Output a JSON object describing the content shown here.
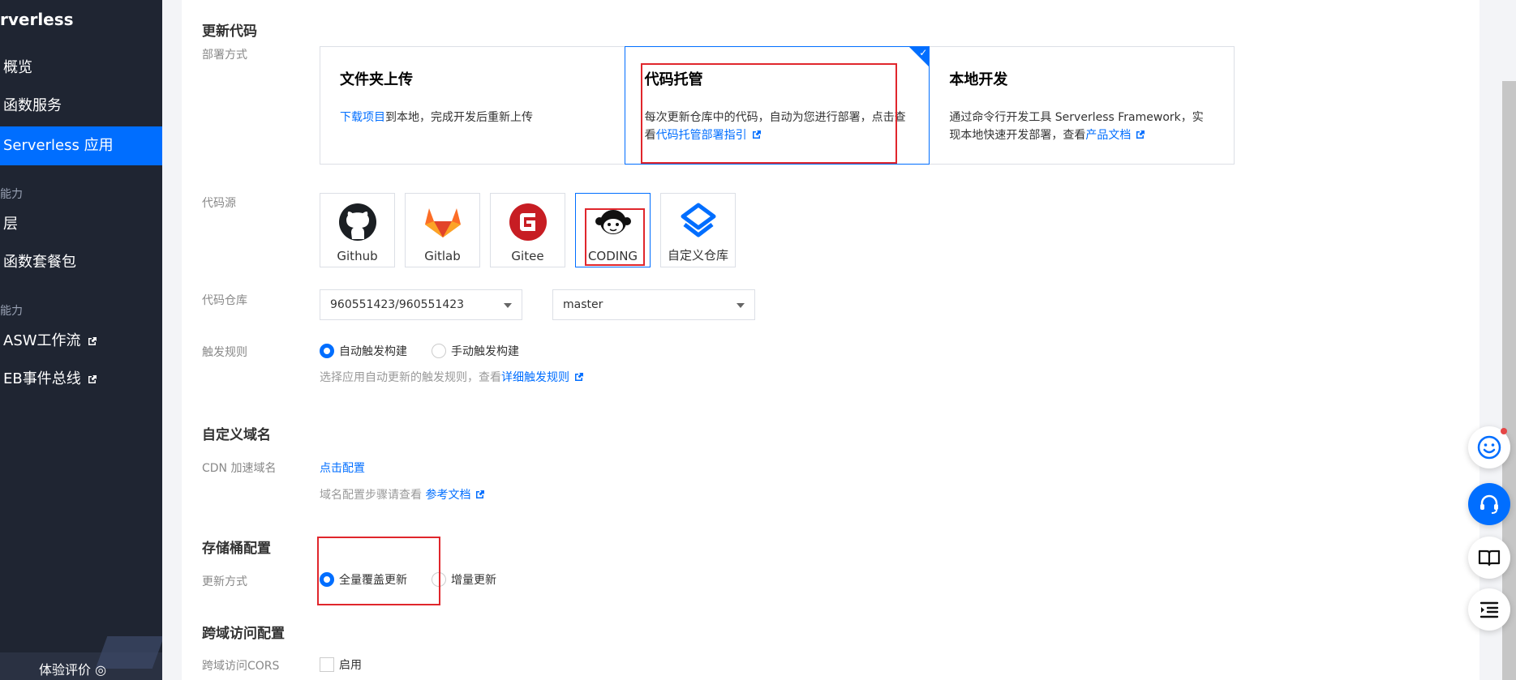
{
  "sidebar": {
    "brand": "rverless",
    "items": [
      {
        "label": "概览"
      },
      {
        "label": "函数服务"
      },
      {
        "label": "Serverless 应用"
      }
    ],
    "group1_label": "能力",
    "group1_items": [
      {
        "label": "层"
      },
      {
        "label": "函数套餐包"
      }
    ],
    "group2_label": "能力",
    "group2_items": [
      {
        "label": "ASW工作流"
      },
      {
        "label": "EB事件总线"
      }
    ],
    "footer_text": "体验评价 ◎"
  },
  "update_code": {
    "title": "更新代码",
    "deploy_label": "部署方式",
    "cards": [
      {
        "title": "文件夹上传",
        "link": "下载项目",
        "text": "到本地，完成开发后重新上传"
      },
      {
        "title": "代码托管",
        "text": "每次更新仓库中的代码，自动为您进行部署，点击查看",
        "link": "代码托管部署指引"
      },
      {
        "title": "本地开发",
        "text": "通过命令行开发工具 Serverless Framework，实现本地快速开发部署，查看",
        "link": "产品文档"
      }
    ],
    "source_label": "代码源",
    "sources": [
      {
        "label": "Github",
        "icon": "github-icon"
      },
      {
        "label": "Gitlab",
        "icon": "gitlab-icon"
      },
      {
        "label": "Gitee",
        "icon": "gitee-icon"
      },
      {
        "label": "CODING",
        "icon": "coding-icon"
      },
      {
        "label": "自定义仓库",
        "icon": "custom-repo-icon"
      }
    ],
    "repo_label": "代码仓库",
    "repo_value": "960551423/960551423",
    "branch_value": "master",
    "trigger_label": "触发规则",
    "trigger_auto": "自动触发构建",
    "trigger_manual": "手动触发构建",
    "trigger_hint": "选择应用自动更新的触发规则，查看",
    "trigger_link": "详细触发规则"
  },
  "domain": {
    "title": "自定义域名",
    "cdn_label": "CDN 加速域名",
    "cdn_link": "点击配置",
    "hint": "域名配置步骤请查看",
    "hint_link": "参考文档"
  },
  "bucket": {
    "title": "存储桶配置",
    "update_label": "更新方式",
    "full": "全量覆盖更新",
    "incremental": "增量更新"
  },
  "cors": {
    "title": "跨域访问配置",
    "label": "跨域访问CORS",
    "enable": "启用"
  },
  "colors": {
    "accent": "#006eff",
    "sidebar": "#1f2532",
    "highlight": "#e0262c"
  }
}
